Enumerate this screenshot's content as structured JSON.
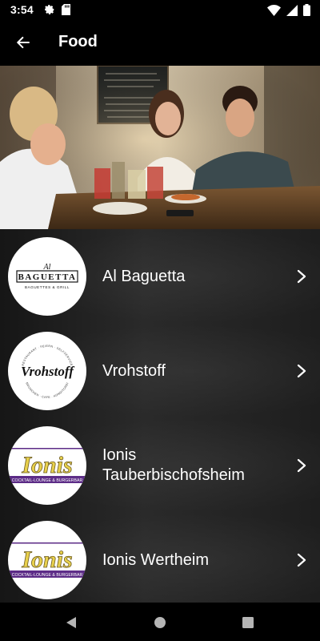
{
  "status": {
    "time": "3:54"
  },
  "appbar": {
    "title": "Food"
  },
  "restaurants": [
    {
      "name": "Al Baguetta",
      "logo_text": "BAGUETTA",
      "logo_sub": "BAGUETTES & GRILL",
      "logo_prefix": "Al"
    },
    {
      "name": "Vrohstoff",
      "logo_text": "Vrohstoff",
      "logo_top": "RESTAURANT · FEIERN · SELFSERVICE",
      "logo_bottom": "BRUNCHEN · CAFE · KONDITOREI"
    },
    {
      "name": "Ionis Tauberbischofsheim",
      "logo_text": "Ionis",
      "logo_sub": "COCKTAIL-LOUNGE & BURGERBAR"
    },
    {
      "name": "Ionis Wertheim",
      "logo_text": "Ionis",
      "logo_sub": "COCKTAIL-LOUNGE & BURGERBAR"
    }
  ],
  "colors": {
    "ionis_purple": "#5b2a86",
    "ionis_yellow": "#e8d04a"
  }
}
